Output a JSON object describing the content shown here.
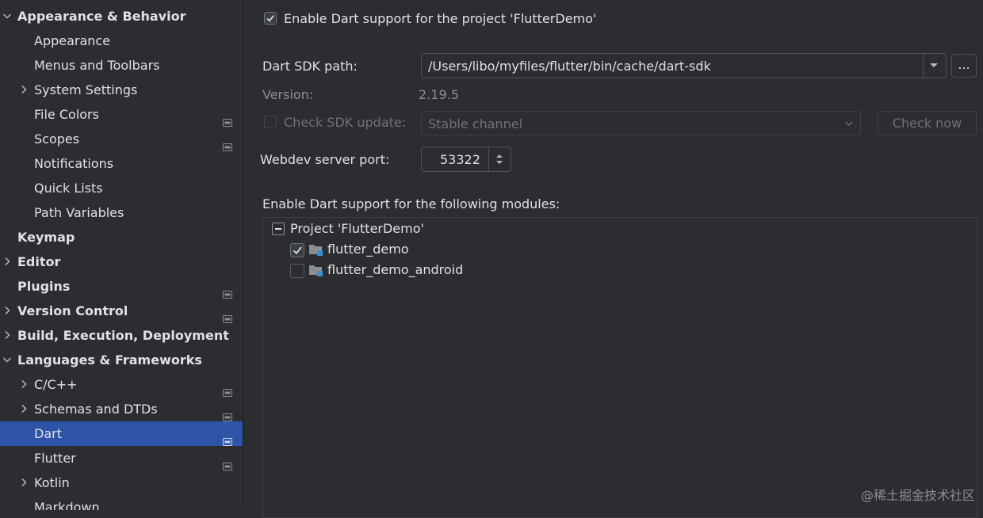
{
  "sidebar": {
    "items": [
      {
        "label": "Appearance & Behavior",
        "level": 0,
        "expanded": true,
        "bold": true,
        "project_icon": false
      },
      {
        "label": "Appearance",
        "level": 1,
        "project_icon": false
      },
      {
        "label": "Menus and Toolbars",
        "level": 1,
        "project_icon": false
      },
      {
        "label": "System Settings",
        "level": 1,
        "collapsed": true,
        "project_icon": false
      },
      {
        "label": "File Colors",
        "level": 1,
        "project_icon": true
      },
      {
        "label": "Scopes",
        "level": 1,
        "project_icon": true
      },
      {
        "label": "Notifications",
        "level": 1,
        "project_icon": false
      },
      {
        "label": "Quick Lists",
        "level": 1,
        "project_icon": false
      },
      {
        "label": "Path Variables",
        "level": 1,
        "project_icon": false
      },
      {
        "label": "Keymap",
        "level": 0,
        "bold": true,
        "project_icon": false
      },
      {
        "label": "Editor",
        "level": 0,
        "collapsed": true,
        "bold": true,
        "project_icon": false
      },
      {
        "label": "Plugins",
        "level": 0,
        "bold": true,
        "project_icon": true
      },
      {
        "label": "Version Control",
        "level": 0,
        "collapsed": true,
        "bold": true,
        "project_icon": true
      },
      {
        "label": "Build, Execution, Deployment",
        "level": 0,
        "collapsed": true,
        "bold": true,
        "project_icon": false
      },
      {
        "label": "Languages & Frameworks",
        "level": 0,
        "expanded": true,
        "bold": true,
        "project_icon": false
      },
      {
        "label": "C/C++",
        "level": 1,
        "collapsed": true,
        "project_icon": true
      },
      {
        "label": "Schemas and DTDs",
        "level": 1,
        "collapsed": true,
        "project_icon": true
      },
      {
        "label": "Dart",
        "level": 1,
        "selected": true,
        "project_icon": true
      },
      {
        "label": "Flutter",
        "level": 1,
        "project_icon": true
      },
      {
        "label": "Kotlin",
        "level": 1,
        "collapsed": true,
        "project_icon": false
      },
      {
        "label": "Markdown",
        "level": 1,
        "project_icon": true
      }
    ]
  },
  "dart": {
    "enable_label": "Enable Dart support for the project 'FlutterDemo'",
    "enable_checked": true,
    "sdk_path_label": "Dart SDK path:",
    "sdk_path_value": "/Users/libo/myfiles/flutter/bin/cache/dart-sdk",
    "browse_label": "...",
    "version_label": "Version:",
    "version_value": "2.19.5",
    "check_sdk_label": "Check SDK update:",
    "check_sdk_checked": false,
    "channel_value": "Stable channel",
    "check_now_label": "Check now",
    "webdev_label": "Webdev server port:",
    "webdev_port": "53322",
    "modules_label": "Enable Dart support for the following modules:",
    "project_node": "Project 'FlutterDemo'",
    "modules": [
      {
        "name": "flutter_demo",
        "checked": true
      },
      {
        "name": "flutter_demo_android",
        "checked": false
      }
    ]
  },
  "watermark": "@稀土掘金技术社区",
  "colors": {
    "selection": "#2e54a8",
    "background": "#2b2d30",
    "text": "#dfe1e5",
    "module_badge": "#3d8fd1"
  }
}
